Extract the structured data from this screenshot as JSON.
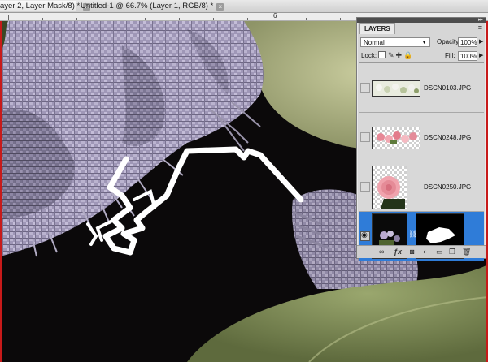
{
  "tabs": [
    {
      "label": "ayer 2, Layer Mask/8) *",
      "close": "×",
      "active": true
    },
    {
      "label": "Untitled-1 @ 66.7% (Layer 1, RGB/8) *",
      "close": "×",
      "active": false
    }
  ],
  "ruler": {
    "label": "6"
  },
  "layers_panel": {
    "tab_label": "LAYERS",
    "menu_icon": "panel-menu-icon",
    "blend_mode": "Normal",
    "opacity_label": "Opacity:",
    "opacity_value": "100%",
    "lock_label": "Lock:",
    "fill_label": "Fill:",
    "fill_value": "100%",
    "layers": [
      {
        "name": "DSCN0103.JPG",
        "visible": false,
        "selected": false
      },
      {
        "name": "DSCN0248.JPG",
        "visible": false,
        "selected": false
      },
      {
        "name": "DSCN0250.JPG",
        "visible": false,
        "selected": false
      },
      {
        "name": "",
        "visible": true,
        "selected": true,
        "has_mask": true
      }
    ],
    "footer_icons": [
      "link-layers-icon",
      "fx-icon",
      "add-mask-icon",
      "adjustment-layer-icon",
      "new-group-icon",
      "new-layer-icon",
      "trash-icon"
    ]
  }
}
